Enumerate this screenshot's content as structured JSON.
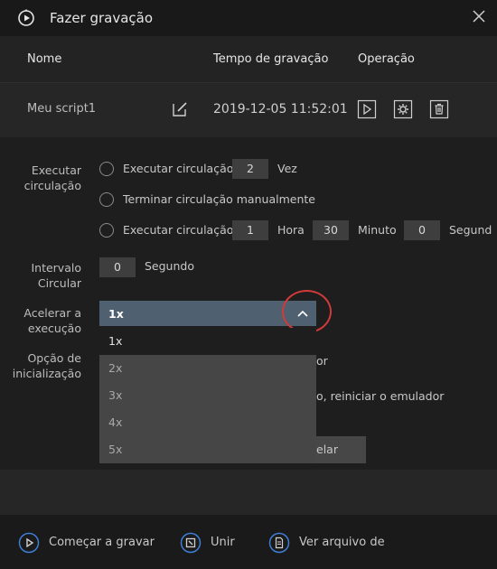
{
  "window": {
    "title": "Fazer gravação",
    "accent": "#3d7fd6"
  },
  "table": {
    "headers": {
      "name": "Nome",
      "time": "Tempo de gravação",
      "op": "Operação"
    },
    "rows": [
      {
        "name": "Meu script1",
        "time": "2019-12-05 11:52:01"
      }
    ]
  },
  "settings": {
    "loop": {
      "label_line1": "Executar",
      "label_line2": "circulação",
      "option1": {
        "label": "Executar circulação",
        "value": "2",
        "unit": "Vez"
      },
      "option2": {
        "label": "Terminar circulação manualmente"
      },
      "option3": {
        "label": "Executar circulação",
        "hours": "1",
        "hours_unit": "Hora",
        "minutes": "30",
        "minutes_unit": "Minuto",
        "seconds": "0",
        "seconds_unit": "Segund"
      }
    },
    "interval": {
      "label_line1": "Intervalo",
      "label_line2": "Circular",
      "value": "0",
      "unit": "Segundo"
    },
    "speed": {
      "label_line1": "Acelerar a",
      "label_line2": "execução",
      "selected": "1x",
      "options": [
        "1x",
        "2x",
        "3x",
        "4x",
        "5x"
      ]
    },
    "startup": {
      "label_line1": "Opção de",
      "label_line2": "inicialização",
      "hidden_text1": "or",
      "hidden_text2": "o, reiniciar o emulador",
      "hidden_button": "elar"
    }
  },
  "footer": {
    "start": "Começar a gravar",
    "merge": "Unir",
    "view": "Ver arquivo de"
  }
}
